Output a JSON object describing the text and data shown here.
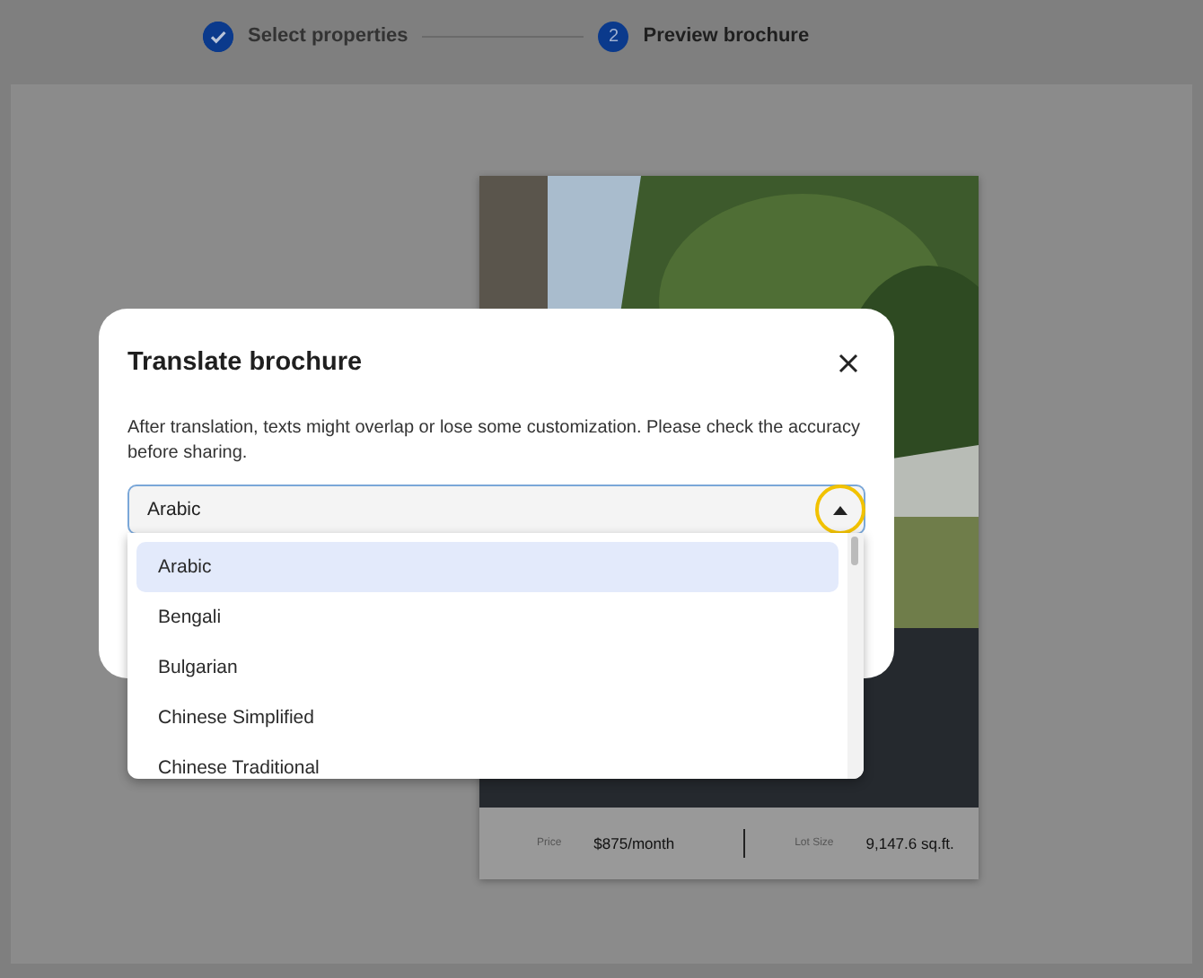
{
  "stepper": {
    "steps": [
      {
        "label": "Select properties",
        "completed": true,
        "selected": false
      },
      {
        "label": "Preview brochure",
        "completed": false,
        "selected": true,
        "number": "2"
      }
    ]
  },
  "brochure": {
    "stats": [
      {
        "label": "Price",
        "value": "$875/month"
      },
      {
        "label": "Lot Size",
        "value": "9,147.6 sq.ft."
      }
    ]
  },
  "dialog": {
    "title": "Translate brochure",
    "message": "After translation, texts might overlap or lose some customization. Please check the accuracy before sharing.",
    "select": {
      "value": "Arabic",
      "expanded": true,
      "highlighted": true,
      "options": [
        {
          "label": "Arabic",
          "selected": true
        },
        {
          "label": "Bengali",
          "selected": false
        },
        {
          "label": "Bulgarian",
          "selected": false
        },
        {
          "label": "Chinese Simplified",
          "selected": false
        },
        {
          "label": "Chinese Traditional",
          "selected": false
        }
      ]
    }
  }
}
